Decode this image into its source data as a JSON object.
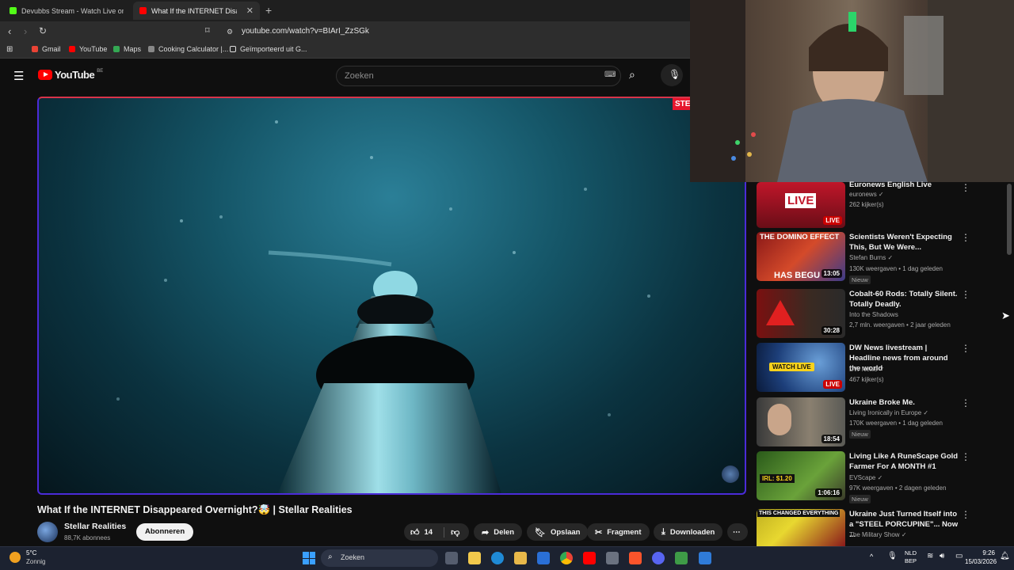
{
  "browser": {
    "tabs": [
      {
        "title": "Devubbs Stream - Watch Live on",
        "favicon_color": "#53fc18"
      },
      {
        "title": "What If the INTERNET Disapp",
        "favicon_color": "#ff0000"
      }
    ],
    "url": "youtube.com/watch?v=BIArI_ZzSGk",
    "bookmarks": [
      {
        "label": "Gmail",
        "icon_color": "#ea4335"
      },
      {
        "label": "YouTube",
        "icon_color": "#ff0000"
      },
      {
        "label": "Maps",
        "icon_color": "#34a853"
      },
      {
        "label": "Cooking Calculator |...",
        "icon_color": "#888888"
      },
      {
        "label": "Geïmporteerd uit G...",
        "icon_color": "#dddddd"
      }
    ]
  },
  "youtube": {
    "logo_text": "YouTube",
    "region": "BE",
    "search_placeholder": "Zoeken",
    "video_overlay_text": "STEL",
    "video": {
      "title": "What If the INTERNET Disappeared Overnight?🤯 | Stellar Realities",
      "channel": "Stellar Realities",
      "subscribers": "88,7K abonnees",
      "subscribe_label": "Abonneren",
      "likes": "14",
      "share_label": "Delen",
      "save_label": "Opslaan",
      "clip_label": "Fragment",
      "download_label": "Downloaden"
    },
    "recommendations": [
      {
        "title": "Euronews English Live",
        "channel": "euronews",
        "meta": "262 kijker(s)",
        "badge": "LIVE",
        "thumb_text": "LIVE",
        "verified": true
      },
      {
        "title": "Scientists Weren't Expecting This, But We Were...",
        "channel": "Stefan Burns",
        "meta": "130K weergaven • 1 dag geleden",
        "badge": "13:05",
        "new": "Nieuw",
        "thumb_top": "THE DOMINO EFFECT",
        "thumb_bottom": "HAS BEGU",
        "verified": true
      },
      {
        "title": "Cobalt-60 Rods: Totally Silent. Totally Deadly.",
        "channel": "Into the Shadows",
        "meta": "2,7 mln. weergaven • 2 jaar geleden",
        "badge": "30:28",
        "verified": false
      },
      {
        "title": "DW News livestream | Headline news from around the world",
        "channel": "DW News",
        "meta": "467 kijker(s)",
        "badge": "LIVE",
        "thumb_text": "WATCH LIVE",
        "verified": true
      },
      {
        "title": "Ukraine Broke Me.",
        "channel": "Living Ironically in Europe",
        "meta": "170K weergaven • 1 dag geleden",
        "badge": "18:54",
        "new": "Nieuw",
        "verified": true
      },
      {
        "title": "Living Like A RuneScape Gold Farmer For A MONTH #1",
        "channel": "EVScape",
        "meta": "97K weergaven • 2 dagen geleden",
        "badge": "1:06:16",
        "new": "Nieuw",
        "thumb_text": "IRL: $1.20",
        "verified": true
      },
      {
        "title": "Ukraine Just Turned Itself into a \"STEEL PORCUPINE\"... Now ...",
        "channel": "The Military Show",
        "meta": "",
        "thumb_top": "THIS CHANGED EVERYTHING",
        "verified": true
      }
    ]
  },
  "taskbar": {
    "weather_temp": "5°C",
    "weather_desc": "Zonnig",
    "search_label": "Zoeken",
    "lang_top": "NLD",
    "lang_bottom": "BEP",
    "time": "9:26",
    "date": "15/03/2026"
  }
}
